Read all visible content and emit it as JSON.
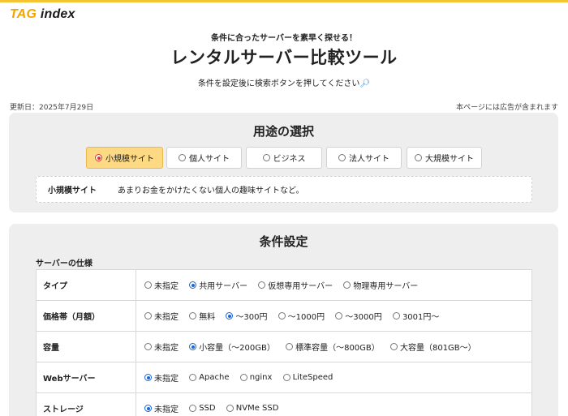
{
  "brand": {
    "logo_tag": "TAG",
    "logo_index": " index"
  },
  "hero": {
    "sub": "条件に合ったサーバーを素早く探せる！",
    "title": "レンタルサーバー比較ツール",
    "desc": "条件を設定後に検索ボタンを押してください",
    "desc_icon": "magnifier-icon"
  },
  "meta": {
    "updated": "更新日：2025年7月29日",
    "ad_note": "本ページには広告が含まれます"
  },
  "purpose": {
    "title": "用途の選択",
    "options": [
      {
        "label": "小規模サイト",
        "selected": true
      },
      {
        "label": "個人サイト",
        "selected": false
      },
      {
        "label": "ビジネス",
        "selected": false
      },
      {
        "label": "法人サイト",
        "selected": false
      },
      {
        "label": "大規模サイト",
        "selected": false
      }
    ],
    "description": {
      "label": "小規模サイト",
      "text": "あまりお金をかけたくない個人の趣味サイトなど。"
    }
  },
  "conditions": {
    "title": "条件設定",
    "section_label": "サーバーの仕様",
    "rows": [
      {
        "label": "タイプ",
        "options": [
          {
            "label": "未指定",
            "selected": false
          },
          {
            "label": "共用サーバー",
            "selected": true
          },
          {
            "label": "仮想専用サーバー",
            "selected": false
          },
          {
            "label": "物理専用サーバー",
            "selected": false
          }
        ]
      },
      {
        "label": "価格帯（月額）",
        "options": [
          {
            "label": "未指定",
            "selected": false
          },
          {
            "label": "無料",
            "selected": false
          },
          {
            "label": "～300円",
            "selected": true
          },
          {
            "label": "～1000円",
            "selected": false
          },
          {
            "label": "～3000円",
            "selected": false
          },
          {
            "label": "3001円～",
            "selected": false
          }
        ]
      },
      {
        "label": "容量",
        "options": [
          {
            "label": "未指定",
            "selected": false
          },
          {
            "label": "小容量（～200GB）",
            "selected": true
          },
          {
            "label": "標準容量（～800GB）",
            "selected": false
          },
          {
            "label": "大容量（801GB～）",
            "selected": false
          }
        ]
      },
      {
        "label": "Webサーバー",
        "options": [
          {
            "label": "未指定",
            "selected": true
          },
          {
            "label": "Apache",
            "selected": false
          },
          {
            "label": "nginx",
            "selected": false
          },
          {
            "label": "LiteSpeed",
            "selected": false
          }
        ]
      },
      {
        "label": "ストレージ",
        "options": [
          {
            "label": "未指定",
            "selected": true
          },
          {
            "label": "SSD",
            "selected": false
          },
          {
            "label": "NVMe SSD",
            "selected": false
          }
        ]
      }
    ]
  }
}
